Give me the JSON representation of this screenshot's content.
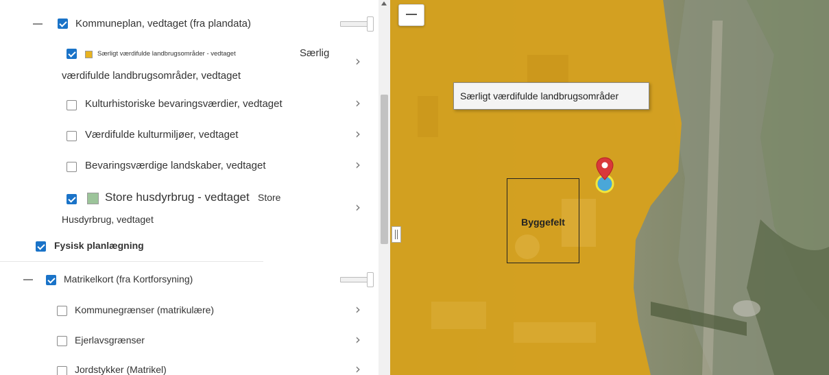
{
  "layers": {
    "kommuneplan": {
      "label": "Kommuneplan, vedtaget (fra plandata)",
      "checked": true
    },
    "saerligt_small": "Særligt værdifulde landbrugsområder - vedtaget",
    "saerligt_line1": "Særlig",
    "saerligt_line2": "værdifulde landbrugsområder, vedtaget",
    "kultur": "Kulturhistoriske bevaringsværdier, vedtaget",
    "vaerdi_kultur": "Værdifulde kulturmiljøer, vedtaget",
    "bevar_land": "Bevaringsværdige landskaber, vedtaget",
    "store_big": "Store husdyrbrug - vedtaget",
    "store_line1": "Store",
    "store_line2": "Husdyrbrug, vedtaget",
    "fysisk": "Fysisk planlægning",
    "matrikel": "Matrikelkort (fra Kortforsyning)",
    "kommunegraenser": "Kommunegrænser (matrikulære)",
    "ejerlav": "Ejerlavsgrænser",
    "jordstykker": "Jordstykker (Matrikel)"
  },
  "map": {
    "tooltip": "Særligt værdifulde landbrugsområder",
    "byggefelt": "Byggefelt"
  },
  "colors": {
    "checkbox": "#1a73c8",
    "overlay": "#d9a21a",
    "swatch_saerligt": "#e8b320",
    "swatch_store": "#9cc49a",
    "marker": "#d9383a"
  },
  "icons": [
    "collapse-icon",
    "chevron-right-icon",
    "map-pin-icon",
    "zoom-out-icon"
  ]
}
